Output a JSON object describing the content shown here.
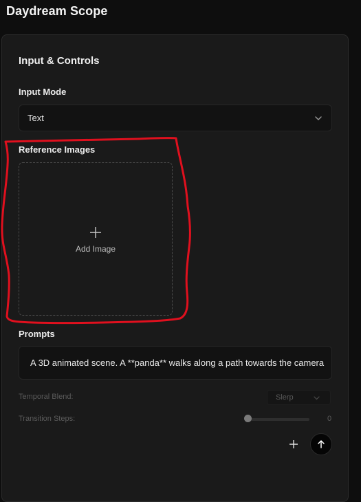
{
  "app": {
    "title": "Daydream Scope"
  },
  "panel": {
    "title": "Input & Controls",
    "input_mode": {
      "label": "Input Mode",
      "value": "Text"
    },
    "reference_images": {
      "label": "Reference Images",
      "add_label": "Add Image"
    },
    "prompts": {
      "label": "Prompts",
      "text": "A 3D animated scene. A **panda** walks along a path towards the camera"
    },
    "temporal_blend": {
      "label": "Temporal Blend:",
      "value": "Slerp"
    },
    "transition_steps": {
      "label": "Transition Steps:",
      "value": "0"
    }
  },
  "colors": {
    "background": "#0e0e0e",
    "panel": "#1a1a1a",
    "annotation": "#e0101e"
  }
}
